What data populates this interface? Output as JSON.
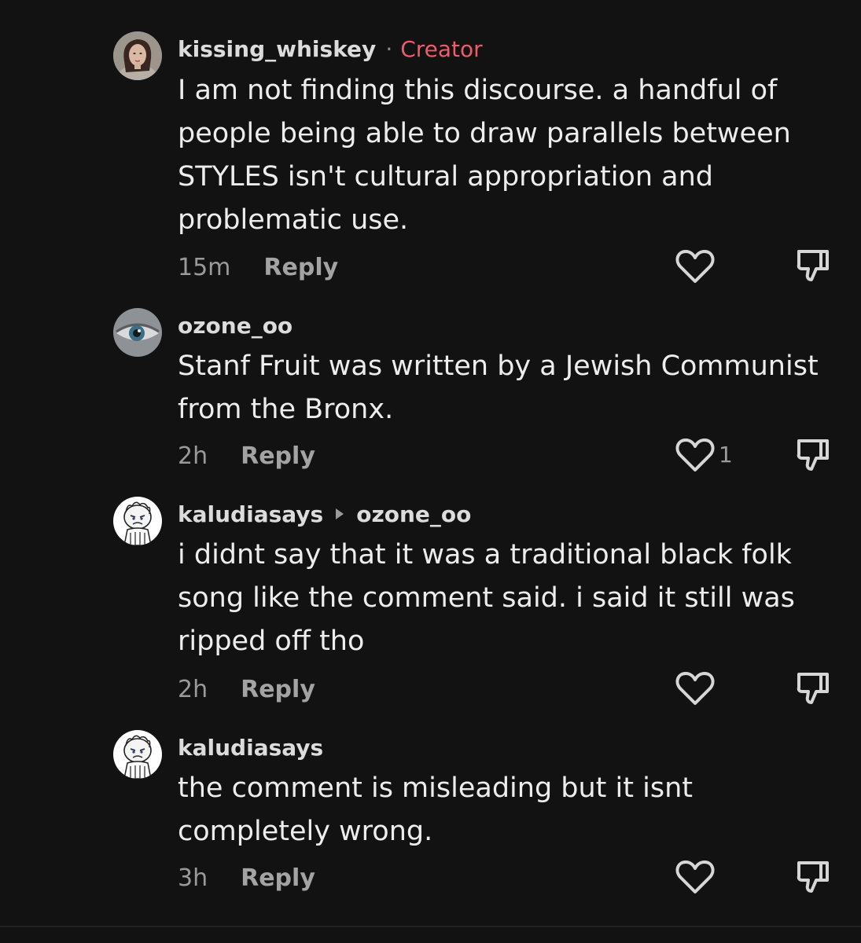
{
  "comments": [
    {
      "username": "kissing_whiskey",
      "separator": "·",
      "badge": "Creator",
      "text_lines": [
        "I am not finding this discourse. a handful of",
        "people being able to draw parallels between",
        "STYLES isn't cultural appropriation and",
        "problematic use."
      ],
      "time": "15m",
      "reply_label": "Reply",
      "like_count": "",
      "avatar": "woman-photo-avatar"
    },
    {
      "username": "ozone_oo",
      "text_lines": [
        "Stanf Fruit was written by a Jewish Communist",
        "from the Bronx."
      ],
      "time": "2h",
      "reply_label": "Reply",
      "like_count": "1",
      "avatar": "eye-photo-avatar"
    },
    {
      "username": "kaludiasays",
      "reply_to": "ozone_oo",
      "text_lines": [
        "i didnt say that it was a traditional black folk",
        "song like the comment said. i said it still was",
        "ripped off tho"
      ],
      "time": "2h",
      "reply_label": "Reply",
      "like_count": "",
      "avatar": "cartoon-character-avatar"
    },
    {
      "username": "kaludiasays",
      "text_lines": [
        "the comment is misleading but it isnt",
        "completely wrong."
      ],
      "time": "3h",
      "reply_label": "Reply",
      "like_count": "",
      "avatar": "cartoon-character-avatar"
    }
  ],
  "colors": {
    "background": "#121212",
    "creator_badge": "#f05a6b",
    "text": "#ededed",
    "muted": "#9a9a9a"
  },
  "icons": {
    "like": "heart-outline-icon",
    "dislike": "thumbs-down-outline-icon",
    "reply_to": "reply-arrow-icon"
  }
}
